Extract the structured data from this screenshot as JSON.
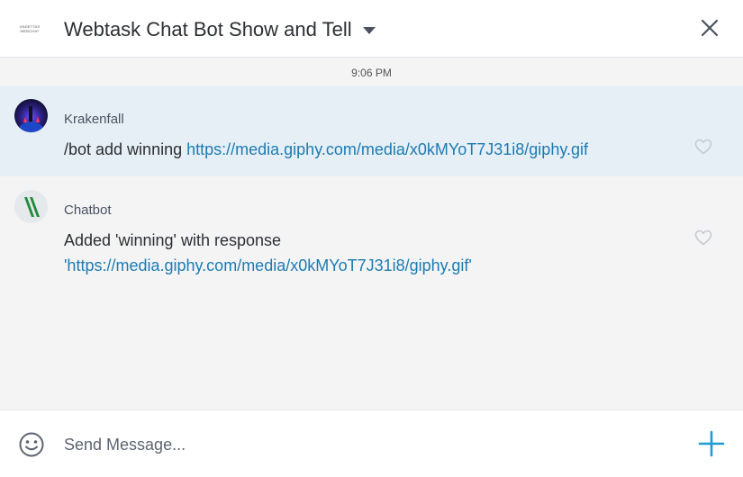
{
  "header": {
    "logo_text": [
      "UNDETTAS",
      "WEBCHAT"
    ],
    "title": "Webtask Chat Bot Show and Tell",
    "close_icon": "close-icon",
    "dropdown_icon": "chevron-down-icon"
  },
  "timeline": {
    "timestamp": "9:06 PM",
    "messages": [
      {
        "author": "Krakenfall",
        "text": "/bot add winning ",
        "link": "https://media.giphy.com/media/x0kMYoT7J31i8/giphy.gif",
        "text_after": "",
        "highlighted": true
      },
      {
        "author": "Chatbot",
        "text": "Added 'winning' with response ",
        "link": "'https://media.giphy.com/media/x0kMYoT7J31i8/giphy.gif'",
        "text_after": "",
        "highlighted": false
      }
    ]
  },
  "composer": {
    "placeholder": "Send Message...",
    "emoji_icon": "emoji-icon",
    "add_icon": "plus-icon"
  },
  "colors": {
    "accent": "#1c7bb3",
    "highlight_bg": "#e6eff6",
    "timeline_bg": "#f4f4f5",
    "plus": "#1e9ad6"
  }
}
